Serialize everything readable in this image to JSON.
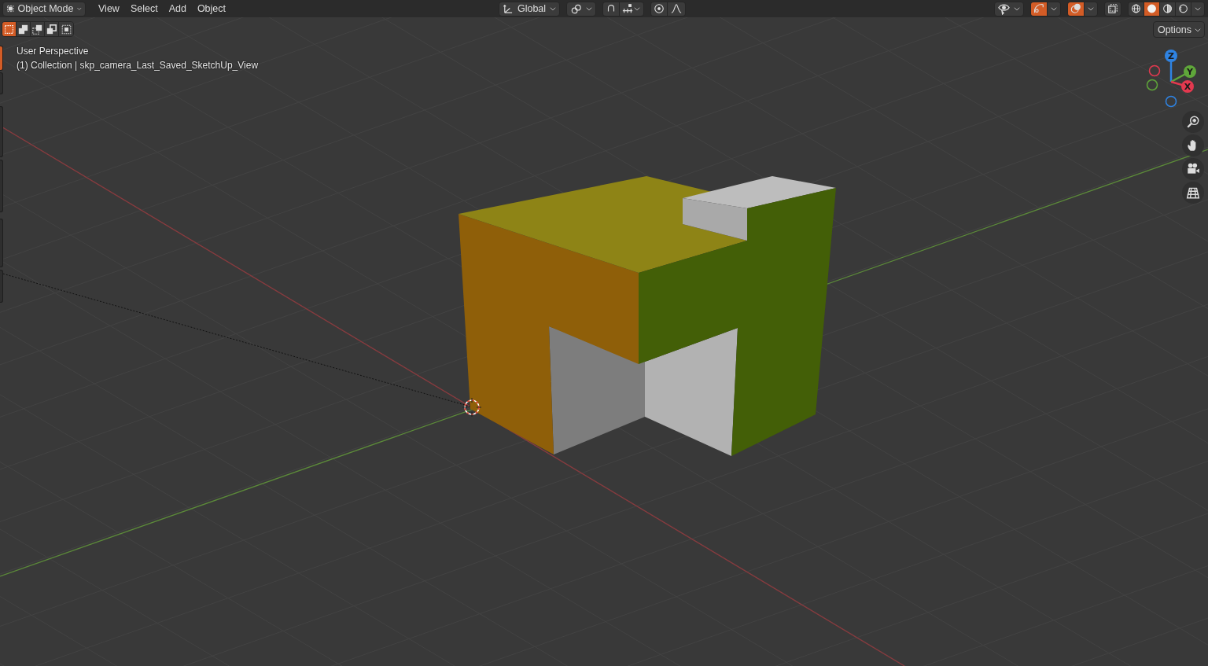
{
  "header": {
    "mode": {
      "label": "Object Mode"
    },
    "menus": [
      {
        "label": "View"
      },
      {
        "label": "Select"
      },
      {
        "label": "Add"
      },
      {
        "label": "Object"
      }
    ],
    "orientation": {
      "label": "Global"
    },
    "snap": {
      "on": false
    },
    "proportional": {
      "on": false
    },
    "gizmos": {
      "on": true
    },
    "overlays": {
      "on": true
    },
    "xray": {
      "on": false
    },
    "shading": [
      {
        "kind": "wireframe",
        "selected": false
      },
      {
        "kind": "solid",
        "selected": true
      },
      {
        "kind": "material",
        "selected": false
      },
      {
        "kind": "rendered",
        "selected": false
      }
    ]
  },
  "tool_header": {
    "select_modes": [
      {
        "kind": "set",
        "selected": true
      },
      {
        "kind": "extend",
        "selected": false
      },
      {
        "kind": "subtract",
        "selected": false
      },
      {
        "kind": "invert",
        "selected": false
      },
      {
        "kind": "intersect",
        "selected": false
      }
    ],
    "options": {
      "label": "Options"
    }
  },
  "toolbar": [
    {
      "selected": true
    },
    {
      "selected": false
    },
    {
      "selected": false
    },
    {
      "selected": false
    },
    {
      "selected": false
    },
    {
      "selected": false
    }
  ],
  "viewport": {
    "view_name": "User Perspective",
    "collection_info": "(1) Collection | skp_camera_Last_Saved_SketchUp_View"
  },
  "gizmo": {
    "axes": [
      {
        "label": "Z",
        "color": "#2f83e2"
      },
      {
        "label": "Y",
        "color": "#5fa63a"
      },
      {
        "label": "X",
        "color": "#e2394f"
      }
    ]
  }
}
